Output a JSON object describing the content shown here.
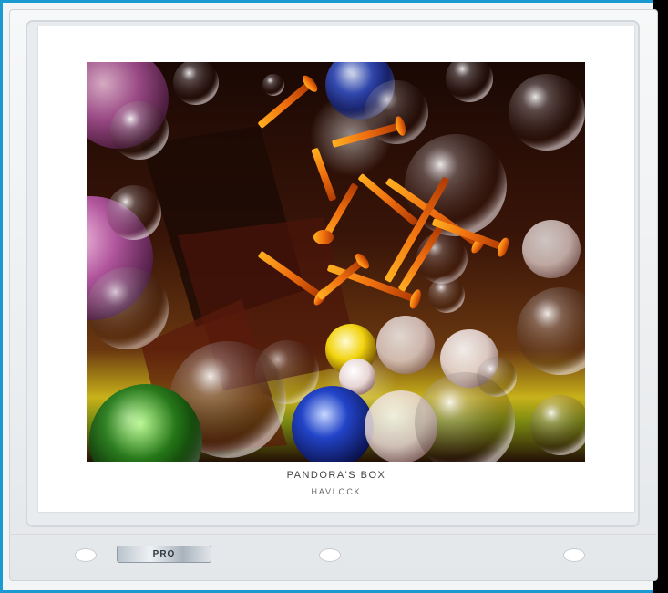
{
  "artwork": {
    "title": "PANDORA'S BOX",
    "artist": "HAVLOCK"
  },
  "sleeve": {
    "brand_tag": "PRO"
  },
  "colors": {
    "frame_border": "#1a9ad1",
    "sleeve": "#f2f4f5",
    "paper": "#ffffff",
    "caption": "#444444"
  }
}
